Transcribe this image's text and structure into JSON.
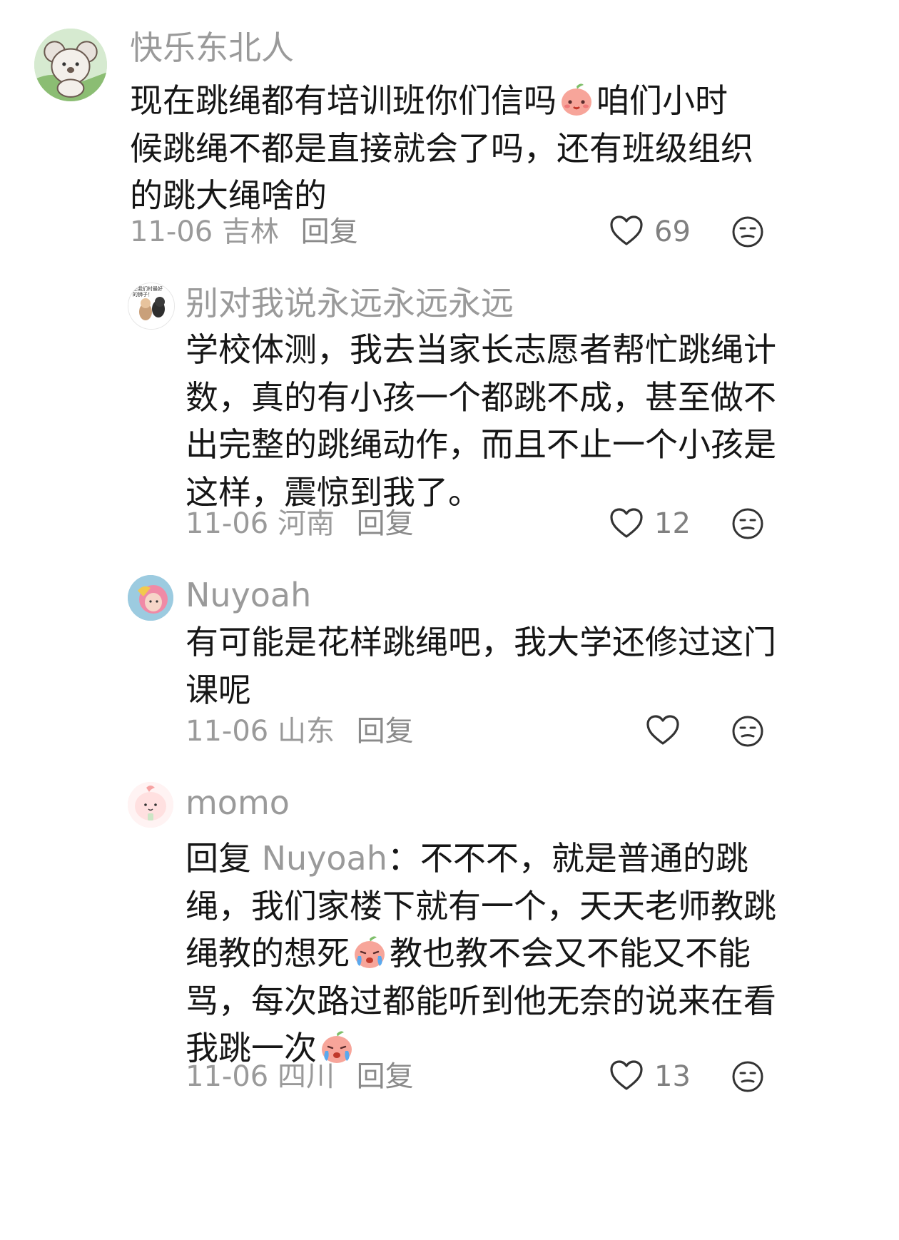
{
  "comments": [
    {
      "username": "快乐东北人",
      "text_parts": [
        "现在跳绳都有培训班你们信吗",
        "咱们小时候跳绳不都是直接就会了吗，还有班级组织的跳大绳啥的"
      ],
      "date": "11-06",
      "location": "吉林",
      "reply_label": "回复",
      "likes": "69",
      "emoji": "peach-smile"
    },
    {
      "username": "别对我说永远永远永远",
      "text": "学校体测，我去当家长志愿者帮忙跳绳计数，真的有小孩一个都跳不成，甚至做不出完整的跳绳动作，而且不止一个小孩是这样，震惊到我了。",
      "date": "11-06",
      "location": "河南",
      "reply_label": "回复",
      "likes": "12",
      "avatar_text": "还我们村最好的狮子！"
    },
    {
      "username": "Nuyoah",
      "text": "有可能是花样跳绳吧，我大学还修过这门课呢",
      "date": "11-06",
      "location": "山东",
      "reply_label": "回复",
      "likes": ""
    },
    {
      "username": "momo",
      "reply_prefix": "回复",
      "mention": "Nuyoah",
      "text_parts": [
        "：不不不，就是普通的跳绳，我们家楼下就有一个，天天老师教跳绳教的想死",
        "教也教不会又不能又不能骂，每次路过都能听到他无奈的说来在看我跳一次"
      ],
      "date": "11-06",
      "location": "四川",
      "reply_label": "回复",
      "likes": "13",
      "emoji": "peach-cry"
    }
  ],
  "colors": {
    "meta_gray": "#9a9a9a",
    "text": "#161616",
    "peach": "#f7a59a",
    "leaf": "#7fbf6a"
  }
}
